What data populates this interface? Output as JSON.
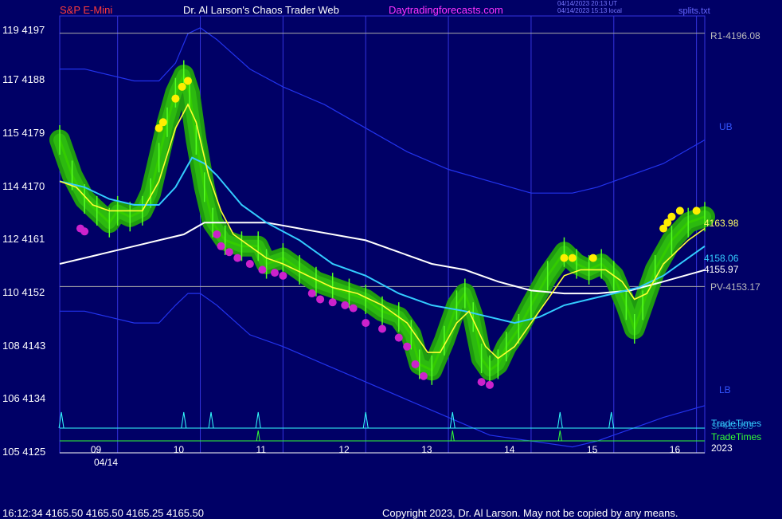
{
  "header": {
    "symbol": "S&P E-Mini",
    "title": "Dr. Al Larson's Chaos Trader Web",
    "site": "Daytradingforecasts.com",
    "stamp1": "04/14/2023 20:13 UT",
    "stamp2": "04/14/2023 15:13 local",
    "split_file": "splits.txt"
  },
  "footer": {
    "quote": "16:12:34  4165.50 4165.50 4165.25 4165.50",
    "copyright": "Copyright 2023, Dr. Al Larson. May not be copied by any means."
  },
  "labels": {
    "r1": "R1-4196.08",
    "pv": "PV-4153.17",
    "ub": "UB",
    "lb": "LB",
    "last": "4163.98",
    "cyan_val": "4158.06",
    "white_val": "4155.97",
    "tt1": "TradeTimes",
    "tt2": "SP4123S3",
    "tt3": "TradeTimes",
    "year": "2023",
    "date": "04/14"
  },
  "colors": {
    "background": "#000066",
    "price": "#33cc00",
    "glow": "#1f9a10",
    "ma_fast": "#ffff33",
    "ma_mid": "#33ccff",
    "ma_slow": "#ffffff",
    "bands": "#2233ee",
    "grid": "#3333dd",
    "up_dots": "#ffee00",
    "down_dots": "#cc22cc",
    "trade_times": "#33ffff",
    "trade_times2": "#33ff33"
  },
  "chart_data": {
    "type": "line",
    "title": "S&P E-Mini",
    "y_ticks": [
      {
        "left": "119",
        "right": "4197"
      },
      {
        "left": "117",
        "right": "4188"
      },
      {
        "left": "115",
        "right": "4179"
      },
      {
        "left": "114",
        "right": "4170"
      },
      {
        "left": "112",
        "right": "4161"
      },
      {
        "left": "110",
        "right": "4152"
      },
      {
        "left": "108",
        "right": "4143"
      },
      {
        "left": "106",
        "right": "4134"
      },
      {
        "left": "105",
        "right": "4125"
      }
    ],
    "ylim": [
      4125,
      4199
    ],
    "xlim": [
      8.3,
      16.1
    ],
    "x_ticks": [
      "09",
      "10",
      "11",
      "12",
      "13",
      "14",
      "15",
      "16"
    ],
    "levels": [
      {
        "name": "R1",
        "value": 4196.08
      },
      {
        "name": "PV",
        "value": 4153.17
      }
    ],
    "price": [
      [
        8.3,
        4178
      ],
      [
        8.45,
        4172
      ],
      [
        8.6,
        4168
      ],
      [
        8.75,
        4166
      ],
      [
        8.9,
        4164
      ],
      [
        9.0,
        4166
      ],
      [
        9.15,
        4165
      ],
      [
        9.3,
        4166
      ],
      [
        9.4,
        4169
      ],
      [
        9.5,
        4175
      ],
      [
        9.6,
        4181
      ],
      [
        9.7,
        4186
      ],
      [
        9.8,
        4189
      ],
      [
        9.87,
        4186
      ],
      [
        9.95,
        4178
      ],
      [
        10.05,
        4170
      ],
      [
        10.15,
        4164
      ],
      [
        10.3,
        4161
      ],
      [
        10.5,
        4160
      ],
      [
        10.7,
        4160
      ],
      [
        10.8,
        4157
      ],
      [
        11.0,
        4158
      ],
      [
        11.2,
        4156
      ],
      [
        11.4,
        4154
      ],
      [
        11.6,
        4153
      ],
      [
        11.8,
        4152
      ],
      [
        12.0,
        4151
      ],
      [
        12.2,
        4149
      ],
      [
        12.4,
        4148
      ],
      [
        12.55,
        4145
      ],
      [
        12.65,
        4140
      ],
      [
        12.8,
        4139
      ],
      [
        12.95,
        4144
      ],
      [
        13.1,
        4150
      ],
      [
        13.2,
        4152
      ],
      [
        13.3,
        4148
      ],
      [
        13.4,
        4141
      ],
      [
        13.5,
        4139
      ],
      [
        13.6,
        4140
      ],
      [
        13.7,
        4143
      ],
      [
        13.85,
        4146
      ],
      [
        14.0,
        4150
      ],
      [
        14.2,
        4155
      ],
      [
        14.4,
        4159
      ],
      [
        14.55,
        4157
      ],
      [
        14.7,
        4156
      ],
      [
        14.85,
        4157
      ],
      [
        15.0,
        4155
      ],
      [
        15.15,
        4150
      ],
      [
        15.25,
        4146
      ],
      [
        15.35,
        4150
      ],
      [
        15.5,
        4156
      ],
      [
        15.7,
        4161
      ],
      [
        15.9,
        4164
      ],
      [
        16.1,
        4165
      ]
    ],
    "ma_fast": [
      [
        8.3,
        4171
      ],
      [
        8.5,
        4170
      ],
      [
        8.7,
        4167
      ],
      [
        8.9,
        4166
      ],
      [
        9.1,
        4166
      ],
      [
        9.3,
        4166
      ],
      [
        9.5,
        4171
      ],
      [
        9.7,
        4180
      ],
      [
        9.85,
        4184
      ],
      [
        9.95,
        4181
      ],
      [
        10.1,
        4172
      ],
      [
        10.25,
        4166
      ],
      [
        10.4,
        4162
      ],
      [
        10.6,
        4160
      ],
      [
        10.8,
        4158
      ],
      [
        11.0,
        4157
      ],
      [
        11.3,
        4155
      ],
      [
        11.6,
        4153
      ],
      [
        11.9,
        4152
      ],
      [
        12.2,
        4150
      ],
      [
        12.5,
        4147
      ],
      [
        12.75,
        4142
      ],
      [
        12.9,
        4142
      ],
      [
        13.1,
        4147
      ],
      [
        13.25,
        4149
      ],
      [
        13.45,
        4143
      ],
      [
        13.6,
        4141
      ],
      [
        13.8,
        4143
      ],
      [
        14.0,
        4147
      ],
      [
        14.2,
        4151
      ],
      [
        14.4,
        4155
      ],
      [
        14.6,
        4156
      ],
      [
        14.9,
        4156
      ],
      [
        15.1,
        4154
      ],
      [
        15.25,
        4151
      ],
      [
        15.4,
        4152
      ],
      [
        15.6,
        4157
      ],
      [
        15.9,
        4161
      ],
      [
        16.1,
        4163
      ]
    ],
    "ma_mid": [
      [
        8.3,
        4171
      ],
      [
        8.6,
        4170
      ],
      [
        8.9,
        4168
      ],
      [
        9.2,
        4167
      ],
      [
        9.5,
        4167
      ],
      [
        9.7,
        4170
      ],
      [
        9.9,
        4175
      ],
      [
        10.05,
        4174
      ],
      [
        10.2,
        4172
      ],
      [
        10.5,
        4167
      ],
      [
        10.8,
        4164
      ],
      [
        11.2,
        4161
      ],
      [
        11.6,
        4157
      ],
      [
        12.0,
        4155
      ],
      [
        12.4,
        4152
      ],
      [
        12.8,
        4150
      ],
      [
        13.2,
        4149
      ],
      [
        13.5,
        4148
      ],
      [
        13.8,
        4147
      ],
      [
        14.1,
        4148
      ],
      [
        14.4,
        4150
      ],
      [
        14.7,
        4151
      ],
      [
        15.0,
        4152
      ],
      [
        15.3,
        4153
      ],
      [
        15.6,
        4155
      ],
      [
        15.9,
        4158
      ],
      [
        16.1,
        4160
      ]
    ],
    "ma_slow": [
      [
        8.3,
        4157
      ],
      [
        8.6,
        4158
      ],
      [
        8.9,
        4159
      ],
      [
        9.2,
        4160
      ],
      [
        9.5,
        4161
      ],
      [
        9.8,
        4162
      ],
      [
        10.05,
        4164
      ],
      [
        10.4,
        4164
      ],
      [
        10.8,
        4164
      ],
      [
        11.2,
        4163
      ],
      [
        11.6,
        4162
      ],
      [
        12.0,
        4161
      ],
      [
        12.4,
        4159
      ],
      [
        12.8,
        4157
      ],
      [
        13.2,
        4156
      ],
      [
        13.6,
        4154
      ],
      [
        14.0,
        4152.5
      ],
      [
        14.4,
        4152
      ],
      [
        14.8,
        4152
      ],
      [
        15.2,
        4152.5
      ],
      [
        15.6,
        4154
      ],
      [
        16.1,
        4155.97
      ]
    ],
    "band_upper": [
      [
        8.3,
        4190
      ],
      [
        8.6,
        4190
      ],
      [
        8.9,
        4189
      ],
      [
        9.2,
        4188
      ],
      [
        9.5,
        4188
      ],
      [
        9.7,
        4191
      ],
      [
        9.85,
        4196
      ],
      [
        10.0,
        4197
      ],
      [
        10.2,
        4195
      ],
      [
        10.6,
        4190
      ],
      [
        11.0,
        4187
      ],
      [
        11.5,
        4184
      ],
      [
        12.0,
        4180
      ],
      [
        12.5,
        4176
      ],
      [
        13.0,
        4173
      ],
      [
        13.5,
        4171
      ],
      [
        14.0,
        4169
      ],
      [
        14.5,
        4169
      ],
      [
        14.8,
        4170
      ],
      [
        15.2,
        4172
      ],
      [
        15.6,
        4174
      ],
      [
        16.1,
        4178
      ]
    ],
    "band_lower": [
      [
        8.3,
        4149
      ],
      [
        8.6,
        4149
      ],
      [
        8.9,
        4148
      ],
      [
        9.2,
        4147
      ],
      [
        9.5,
        4147
      ],
      [
        9.7,
        4150
      ],
      [
        9.85,
        4152
      ],
      [
        10.0,
        4152
      ],
      [
        10.2,
        4150
      ],
      [
        10.6,
        4145
      ],
      [
        11.0,
        4143
      ],
      [
        11.5,
        4140
      ],
      [
        12.0,
        4137
      ],
      [
        12.5,
        4134
      ],
      [
        13.0,
        4131
      ],
      [
        13.5,
        4128
      ],
      [
        14.0,
        4127
      ],
      [
        14.5,
        4126
      ],
      [
        14.8,
        4127
      ],
      [
        15.2,
        4129
      ],
      [
        15.6,
        4131
      ],
      [
        16.1,
        4133
      ]
    ],
    "trade_times_1": [
      8.32,
      9.8,
      10.13,
      10.7,
      12.0,
      13.05,
      14.35,
      14.97
    ],
    "trade_times_2": [
      10.7,
      13.05,
      14.35
    ],
    "up_dots": [
      [
        9.5,
        4180
      ],
      [
        9.55,
        4181
      ],
      [
        9.7,
        4185
      ],
      [
        9.78,
        4187
      ],
      [
        9.85,
        4188
      ],
      [
        14.4,
        4158
      ],
      [
        14.5,
        4158
      ],
      [
        14.75,
        4158
      ],
      [
        15.6,
        4163
      ],
      [
        15.65,
        4164
      ],
      [
        15.7,
        4165
      ],
      [
        15.8,
        4166
      ],
      [
        16.0,
        4166
      ]
    ],
    "down_dots": [
      [
        8.55,
        4163
      ],
      [
        8.6,
        4162.5
      ],
      [
        10.2,
        4162
      ],
      [
        10.25,
        4160
      ],
      [
        10.35,
        4159
      ],
      [
        10.45,
        4158
      ],
      [
        10.6,
        4157
      ],
      [
        10.75,
        4156
      ],
      [
        10.9,
        4155.5
      ],
      [
        11.0,
        4155
      ],
      [
        11.35,
        4152
      ],
      [
        11.45,
        4151
      ],
      [
        11.6,
        4150.5
      ],
      [
        11.75,
        4150
      ],
      [
        11.85,
        4149.5
      ],
      [
        12.0,
        4147
      ],
      [
        12.2,
        4146
      ],
      [
        12.4,
        4144.5
      ],
      [
        12.5,
        4143
      ],
      [
        12.6,
        4140
      ],
      [
        12.7,
        4138
      ],
      [
        13.4,
        4137
      ],
      [
        13.5,
        4136.5
      ]
    ]
  }
}
